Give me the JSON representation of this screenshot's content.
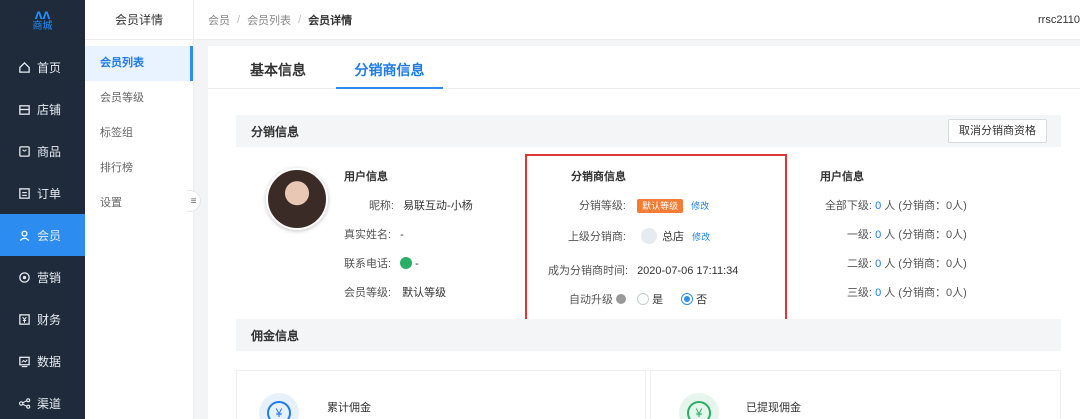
{
  "logo": {
    "mark": "ᴧᴧ",
    "text": "商城"
  },
  "nav": [
    {
      "label": "首页",
      "icon": "home-icon"
    },
    {
      "label": "店铺",
      "icon": "store-icon"
    },
    {
      "label": "商品",
      "icon": "goods-icon"
    },
    {
      "label": "订单",
      "icon": "order-icon"
    },
    {
      "label": "会员",
      "icon": "user-icon",
      "active": true
    },
    {
      "label": "营销",
      "icon": "marketing-icon"
    },
    {
      "label": "财务",
      "icon": "finance-icon"
    },
    {
      "label": "数据",
      "icon": "data-icon"
    },
    {
      "label": "渠道",
      "icon": "channel-icon"
    }
  ],
  "subnav": {
    "title": "会员详情",
    "items": [
      "会员列表",
      "会员等级",
      "标签组",
      "排行榜",
      "设置"
    ],
    "collapse_icon": "≡"
  },
  "breadcrumb": [
    "会员",
    "会员列表",
    "会员详情"
  ],
  "user": "rrsc2110",
  "tabs": [
    "基本信息",
    "分销商信息"
  ],
  "distribution": {
    "title": "分销信息",
    "cancel_button": "取消分销商资格",
    "user_info": {
      "title": "用户信息",
      "nickname_label": "昵称:",
      "nickname": "易联互动-小杨",
      "realname_label": "真实姓名:",
      "realname": "-",
      "phone_label": "联系电话:",
      "phone": "-",
      "level_label": "会员等级:",
      "level": "默认等级"
    },
    "distributor_info": {
      "title": "分销商信息",
      "grade_label": "分销等级:",
      "grade_badge": "默认等级",
      "edit": "修改",
      "parent_label": "上级分销商:",
      "parent": "总店",
      "parent_edit": "修改",
      "since_label": "成为分销商时间:",
      "since": "2020-07-06 17:11:34",
      "auto_label": "自动升级",
      "yes": "是",
      "no": "否"
    },
    "downline_info": {
      "title": "用户信息",
      "rows": [
        {
          "label": "全部下级:",
          "count": "0",
          "unit": "人 (分销商：0人)"
        },
        {
          "label": "一级:",
          "count": "0",
          "unit": "人 (分销商：0人)"
        },
        {
          "label": "二级:",
          "count": "0",
          "unit": "人 (分销商：0人)"
        },
        {
          "label": "三级:",
          "count": "0",
          "unit": "人 (分销商：0人)"
        }
      ]
    }
  },
  "commission": {
    "title": "佣金信息",
    "cards": [
      {
        "label": "累计佣金",
        "icon": "yen-icon",
        "symbol": "¥"
      },
      {
        "label": "已提现佣金",
        "icon": "yen-withdrawn-icon",
        "symbol": "¥"
      }
    ]
  },
  "colors": {
    "accent": "#2d8cf0",
    "sidebar": "#1f2b3b",
    "highlight_box": "#e03636",
    "badge": "#f57c34"
  }
}
